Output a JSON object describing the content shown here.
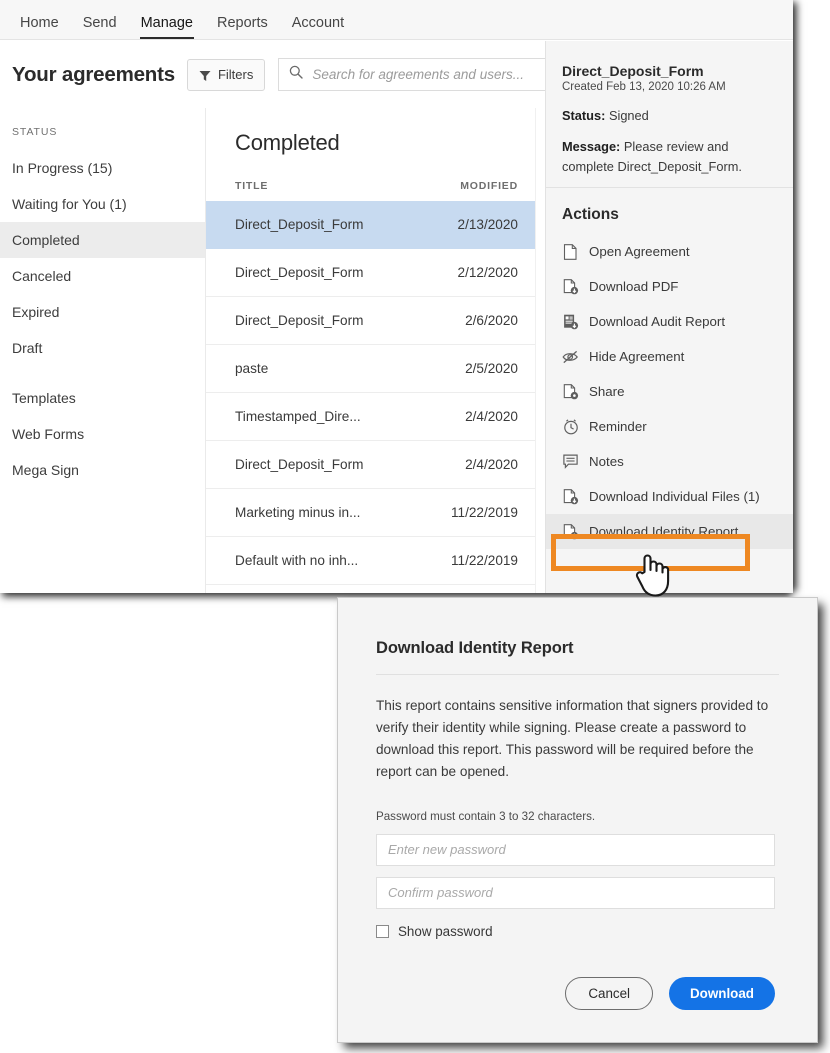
{
  "topnav": {
    "items": [
      {
        "label": "Home",
        "active": false
      },
      {
        "label": "Send",
        "active": false
      },
      {
        "label": "Manage",
        "active": true
      },
      {
        "label": "Reports",
        "active": false
      },
      {
        "label": "Account",
        "active": false
      }
    ]
  },
  "header": {
    "title": "Your agreements",
    "filters_label": "Filters",
    "search_placeholder": "Search for agreements and users..."
  },
  "sidebar": {
    "section_label": "STATUS",
    "status_items": [
      {
        "label": "In Progress (15)",
        "selected": false
      },
      {
        "label": "Waiting for You (1)",
        "selected": false
      },
      {
        "label": "Completed",
        "selected": true
      },
      {
        "label": "Canceled",
        "selected": false
      },
      {
        "label": "Expired",
        "selected": false
      },
      {
        "label": "Draft",
        "selected": false
      }
    ],
    "other_items": [
      {
        "label": "Templates"
      },
      {
        "label": "Web Forms"
      },
      {
        "label": "Mega Sign"
      }
    ]
  },
  "list": {
    "title": "Completed",
    "columns": {
      "title": "TITLE",
      "modified": "MODIFIED"
    },
    "rows": [
      {
        "title": "Direct_Deposit_Form",
        "modified": "2/13/2020",
        "selected": true
      },
      {
        "title": "Direct_Deposit_Form",
        "modified": "2/12/2020",
        "selected": false
      },
      {
        "title": "Direct_Deposit_Form",
        "modified": "2/6/2020",
        "selected": false
      },
      {
        "title": "paste",
        "modified": "2/5/2020",
        "selected": false
      },
      {
        "title": "Timestamped_Dire...",
        "modified": "2/4/2020",
        "selected": false
      },
      {
        "title": "Direct_Deposit_Form",
        "modified": "2/4/2020",
        "selected": false
      },
      {
        "title": "Marketing minus in...",
        "modified": "11/22/2019",
        "selected": false
      },
      {
        "title": "Default with no inh...",
        "modified": "11/22/2019",
        "selected": false
      }
    ]
  },
  "detail": {
    "title": "Direct_Deposit_Form",
    "created": "Created Feb 13, 2020 10:26 AM",
    "status_label": "Status:",
    "status_value": "Signed",
    "message_label": "Message:",
    "message_value": "Please review and complete Direct_Deposit_Form.",
    "actions_title": "Actions",
    "actions": [
      {
        "label": "Open Agreement",
        "icon": "document-icon",
        "highlighted": false
      },
      {
        "label": "Download PDF",
        "icon": "download-pdf-icon",
        "highlighted": false
      },
      {
        "label": "Download Audit Report",
        "icon": "download-audit-icon",
        "highlighted": false
      },
      {
        "label": "Hide Agreement",
        "icon": "eye-slash-icon",
        "highlighted": false
      },
      {
        "label": "Share",
        "icon": "share-icon",
        "highlighted": false
      },
      {
        "label": "Reminder",
        "icon": "clock-icon",
        "highlighted": false
      },
      {
        "label": "Notes",
        "icon": "notes-icon",
        "highlighted": false
      },
      {
        "label": "Download Individual Files (1)",
        "icon": "download-file-icon",
        "highlighted": false
      },
      {
        "label": "Download Identity Report",
        "icon": "download-file-icon",
        "highlighted": true
      }
    ]
  },
  "callout": {
    "color": "#ee8822",
    "target": "Download Identity Report"
  },
  "modal": {
    "title": "Download Identity Report",
    "body": "This report contains sensitive information that signers provided to verify their identity while signing. Please create a password to download this report. This password will be required before the report can be opened.",
    "hint": "Password must contain 3 to 32 characters.",
    "new_password_placeholder": "Enter new password",
    "new_password_value": "",
    "confirm_password_placeholder": "Confirm password",
    "confirm_password_value": "",
    "show_password_label": "Show password",
    "show_password_checked": false,
    "cancel_label": "Cancel",
    "download_label": "Download",
    "download_color": "#1473e6"
  }
}
